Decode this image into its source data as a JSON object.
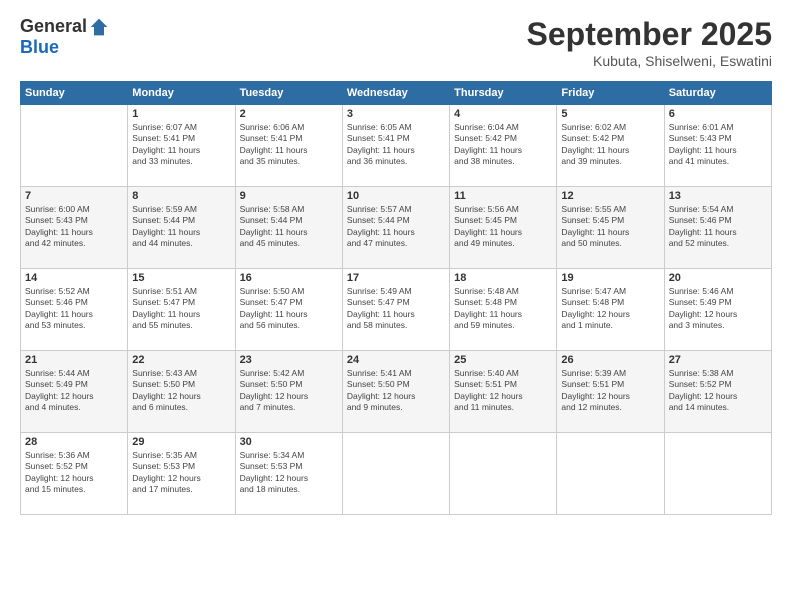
{
  "logo": {
    "general": "General",
    "blue": "Blue"
  },
  "title": "September 2025",
  "subtitle": "Kubuta, Shiselweni, Eswatini",
  "days_of_week": [
    "Sunday",
    "Monday",
    "Tuesday",
    "Wednesday",
    "Thursday",
    "Friday",
    "Saturday"
  ],
  "weeks": [
    [
      {
        "day": "",
        "info": ""
      },
      {
        "day": "1",
        "info": "Sunrise: 6:07 AM\nSunset: 5:41 PM\nDaylight: 11 hours\nand 33 minutes."
      },
      {
        "day": "2",
        "info": "Sunrise: 6:06 AM\nSunset: 5:41 PM\nDaylight: 11 hours\nand 35 minutes."
      },
      {
        "day": "3",
        "info": "Sunrise: 6:05 AM\nSunset: 5:41 PM\nDaylight: 11 hours\nand 36 minutes."
      },
      {
        "day": "4",
        "info": "Sunrise: 6:04 AM\nSunset: 5:42 PM\nDaylight: 11 hours\nand 38 minutes."
      },
      {
        "day": "5",
        "info": "Sunrise: 6:02 AM\nSunset: 5:42 PM\nDaylight: 11 hours\nand 39 minutes."
      },
      {
        "day": "6",
        "info": "Sunrise: 6:01 AM\nSunset: 5:43 PM\nDaylight: 11 hours\nand 41 minutes."
      }
    ],
    [
      {
        "day": "7",
        "info": "Sunrise: 6:00 AM\nSunset: 5:43 PM\nDaylight: 11 hours\nand 42 minutes."
      },
      {
        "day": "8",
        "info": "Sunrise: 5:59 AM\nSunset: 5:44 PM\nDaylight: 11 hours\nand 44 minutes."
      },
      {
        "day": "9",
        "info": "Sunrise: 5:58 AM\nSunset: 5:44 PM\nDaylight: 11 hours\nand 45 minutes."
      },
      {
        "day": "10",
        "info": "Sunrise: 5:57 AM\nSunset: 5:44 PM\nDaylight: 11 hours\nand 47 minutes."
      },
      {
        "day": "11",
        "info": "Sunrise: 5:56 AM\nSunset: 5:45 PM\nDaylight: 11 hours\nand 49 minutes."
      },
      {
        "day": "12",
        "info": "Sunrise: 5:55 AM\nSunset: 5:45 PM\nDaylight: 11 hours\nand 50 minutes."
      },
      {
        "day": "13",
        "info": "Sunrise: 5:54 AM\nSunset: 5:46 PM\nDaylight: 11 hours\nand 52 minutes."
      }
    ],
    [
      {
        "day": "14",
        "info": "Sunrise: 5:52 AM\nSunset: 5:46 PM\nDaylight: 11 hours\nand 53 minutes."
      },
      {
        "day": "15",
        "info": "Sunrise: 5:51 AM\nSunset: 5:47 PM\nDaylight: 11 hours\nand 55 minutes."
      },
      {
        "day": "16",
        "info": "Sunrise: 5:50 AM\nSunset: 5:47 PM\nDaylight: 11 hours\nand 56 minutes."
      },
      {
        "day": "17",
        "info": "Sunrise: 5:49 AM\nSunset: 5:47 PM\nDaylight: 11 hours\nand 58 minutes."
      },
      {
        "day": "18",
        "info": "Sunrise: 5:48 AM\nSunset: 5:48 PM\nDaylight: 11 hours\nand 59 minutes."
      },
      {
        "day": "19",
        "info": "Sunrise: 5:47 AM\nSunset: 5:48 PM\nDaylight: 12 hours\nand 1 minute."
      },
      {
        "day": "20",
        "info": "Sunrise: 5:46 AM\nSunset: 5:49 PM\nDaylight: 12 hours\nand 3 minutes."
      }
    ],
    [
      {
        "day": "21",
        "info": "Sunrise: 5:44 AM\nSunset: 5:49 PM\nDaylight: 12 hours\nand 4 minutes."
      },
      {
        "day": "22",
        "info": "Sunrise: 5:43 AM\nSunset: 5:50 PM\nDaylight: 12 hours\nand 6 minutes."
      },
      {
        "day": "23",
        "info": "Sunrise: 5:42 AM\nSunset: 5:50 PM\nDaylight: 12 hours\nand 7 minutes."
      },
      {
        "day": "24",
        "info": "Sunrise: 5:41 AM\nSunset: 5:50 PM\nDaylight: 12 hours\nand 9 minutes."
      },
      {
        "day": "25",
        "info": "Sunrise: 5:40 AM\nSunset: 5:51 PM\nDaylight: 12 hours\nand 11 minutes."
      },
      {
        "day": "26",
        "info": "Sunrise: 5:39 AM\nSunset: 5:51 PM\nDaylight: 12 hours\nand 12 minutes."
      },
      {
        "day": "27",
        "info": "Sunrise: 5:38 AM\nSunset: 5:52 PM\nDaylight: 12 hours\nand 14 minutes."
      }
    ],
    [
      {
        "day": "28",
        "info": "Sunrise: 5:36 AM\nSunset: 5:52 PM\nDaylight: 12 hours\nand 15 minutes."
      },
      {
        "day": "29",
        "info": "Sunrise: 5:35 AM\nSunset: 5:53 PM\nDaylight: 12 hours\nand 17 minutes."
      },
      {
        "day": "30",
        "info": "Sunrise: 5:34 AM\nSunset: 5:53 PM\nDaylight: 12 hours\nand 18 minutes."
      },
      {
        "day": "",
        "info": ""
      },
      {
        "day": "",
        "info": ""
      },
      {
        "day": "",
        "info": ""
      },
      {
        "day": "",
        "info": ""
      }
    ]
  ]
}
